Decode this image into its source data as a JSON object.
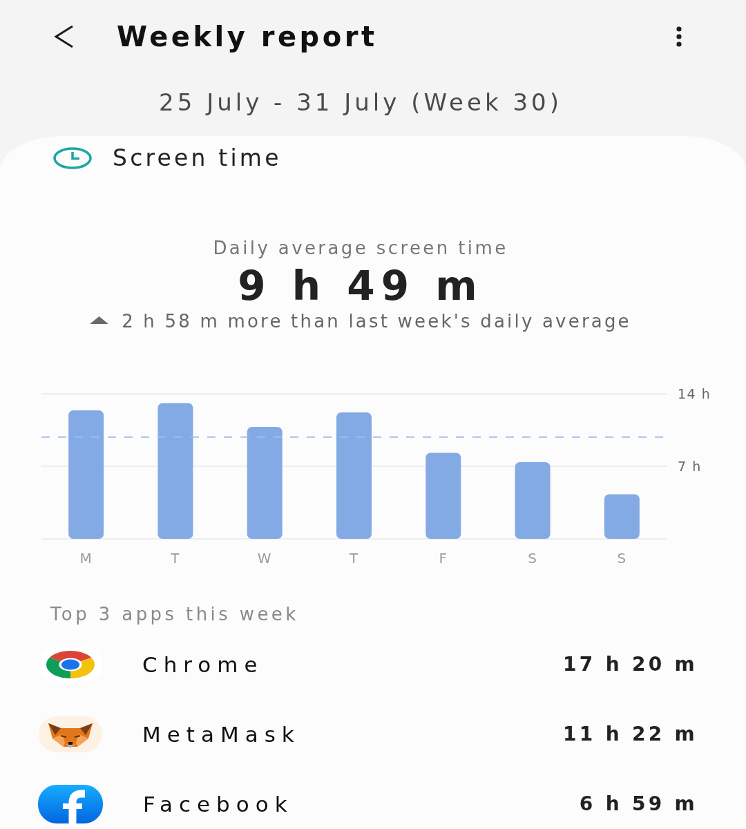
{
  "header": {
    "title": "Weekly report"
  },
  "date_range": "25 July - 31 July (Week 30)",
  "screen_time": {
    "title": "Screen time",
    "average_label": "Daily average screen time",
    "average_value": "9 h 49 m",
    "comparison": {
      "increased": true,
      "text": "2 h 58 m more than last week's daily average"
    },
    "chart_data": {
      "type": "bar",
      "categories": [
        "M",
        "T",
        "W",
        "T",
        "F",
        "S",
        "S"
      ],
      "values": [
        12.4,
        13.1,
        10.8,
        12.2,
        8.3,
        7.4,
        4.3
      ],
      "ylim": [
        0,
        14
      ],
      "yticks": [
        {
          "value": 7,
          "label": "7 h"
        },
        {
          "value": 14,
          "label": "14 h"
        }
      ],
      "ref_lines": [
        {
          "axis": "y",
          "value": 9.82
        }
      ]
    }
  },
  "top_apps": {
    "title": "Top 3 apps this week",
    "apps": [
      {
        "name": "Chrome",
        "time": "17 h 20 m"
      },
      {
        "name": "MetaMask",
        "time": "11 h 22 m"
      },
      {
        "name": "Facebook",
        "time": "6 h 59 m"
      }
    ]
  }
}
